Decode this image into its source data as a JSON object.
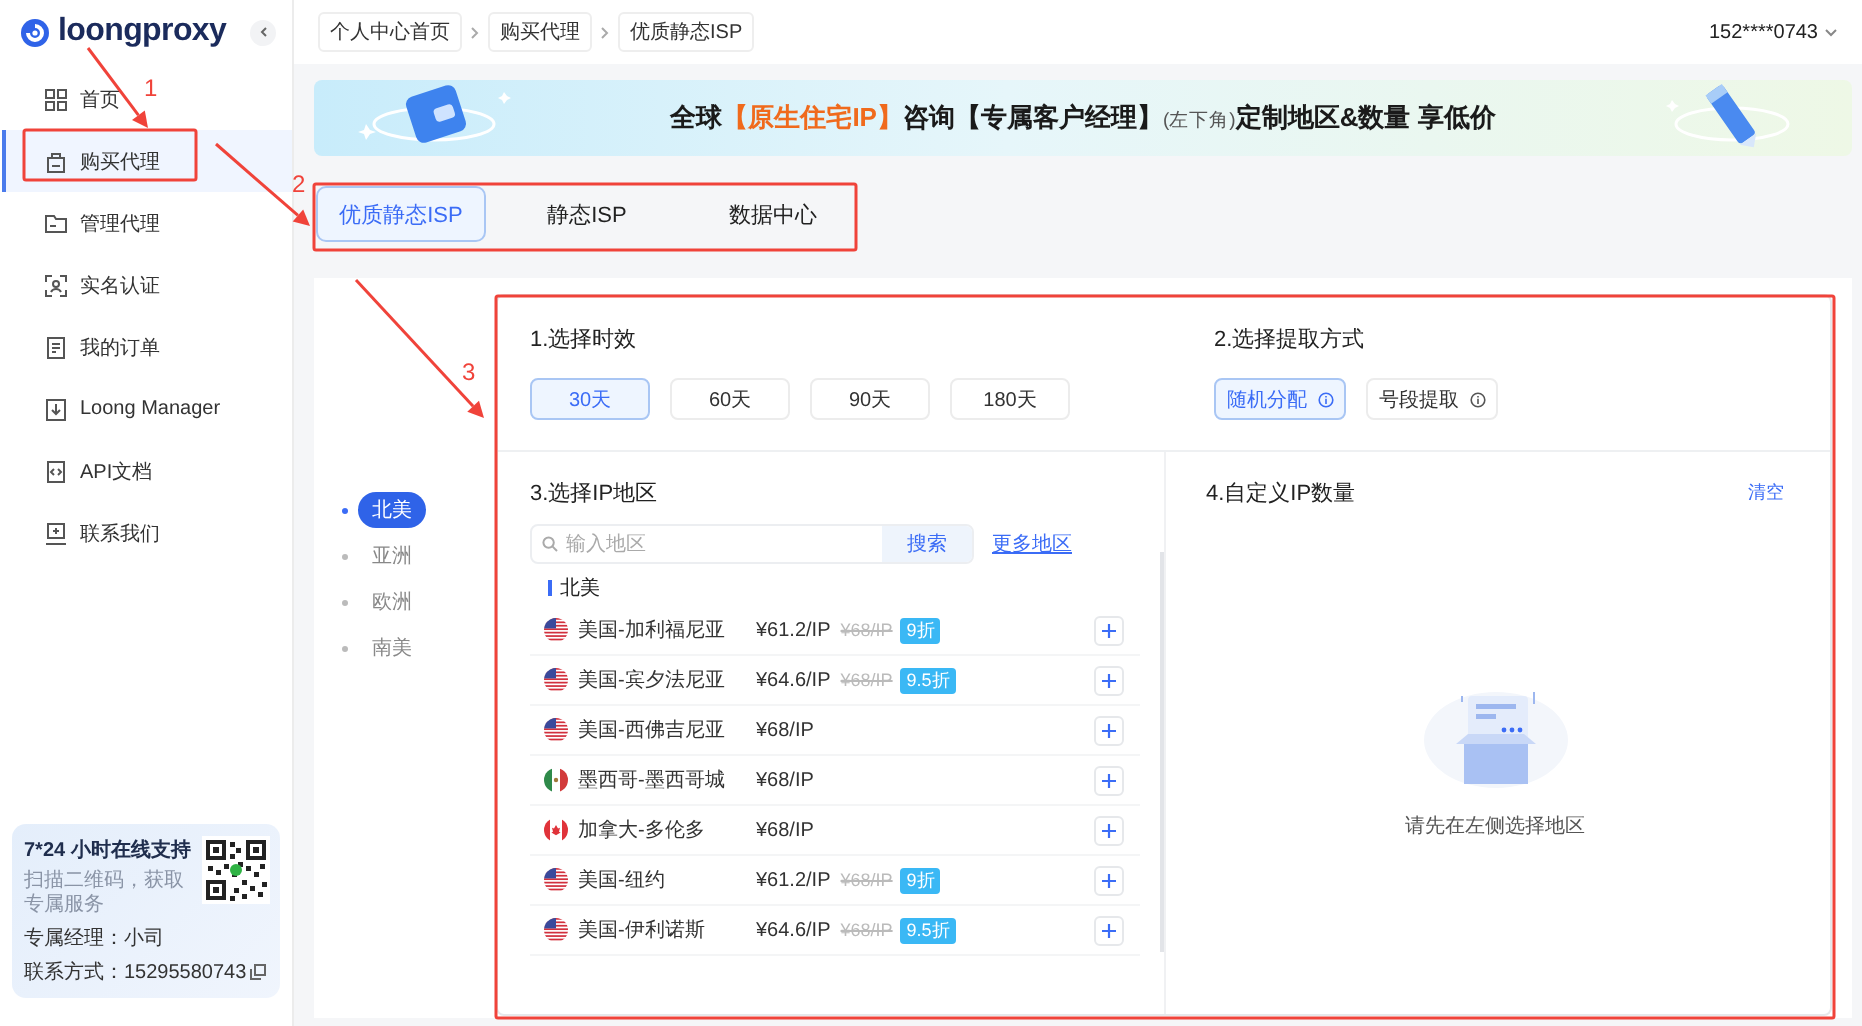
{
  "sidebar": {
    "logo": "loongproxy",
    "items": [
      {
        "label": "首页",
        "selected": false
      },
      {
        "label": "购买代理",
        "selected": true
      },
      {
        "label": "管理代理",
        "selected": false
      },
      {
        "label": "实名认证",
        "selected": false
      },
      {
        "label": "我的订单",
        "selected": false
      },
      {
        "label": "Loong Manager",
        "selected": false
      },
      {
        "label": "API文档",
        "selected": false
      },
      {
        "label": "联系我们",
        "selected": false
      }
    ],
    "support": {
      "title": "7*24 小时在线支持",
      "subtitle": "扫描二维码，获取专属服务",
      "manager": "专属经理：小司",
      "contact": "联系方式：15295580743"
    }
  },
  "topbar": {
    "breadcrumbs": [
      "个人中心首页",
      "购买代理",
      "优质静态ISP"
    ],
    "user": "152****0743"
  },
  "banner": {
    "segments": [
      {
        "kind": "normal",
        "text": "全球"
      },
      {
        "kind": "highlight",
        "text": "【原生住宅IP】"
      },
      {
        "kind": "normal",
        "text": "咨询【专属客户经理】"
      },
      {
        "kind": "note",
        "text": "(左下角)"
      },
      {
        "kind": "normal",
        "text": "定制地区&数量 享低价"
      }
    ]
  },
  "tabs": [
    {
      "label": "优质静态ISP",
      "selected": true
    },
    {
      "label": "静态ISP",
      "selected": false
    },
    {
      "label": "数据中心",
      "selected": false
    }
  ],
  "continents": [
    {
      "label": "北美",
      "selected": true
    },
    {
      "label": "亚洲",
      "selected": false
    },
    {
      "label": "欧洲",
      "selected": false
    },
    {
      "label": "南美",
      "selected": false
    }
  ],
  "duration": {
    "title": "1.选择时效",
    "options": [
      {
        "label": "30天",
        "selected": true
      },
      {
        "label": "60天",
        "selected": false
      },
      {
        "label": "90天",
        "selected": false
      },
      {
        "label": "180天",
        "selected": false
      }
    ]
  },
  "mode": {
    "title": "2.选择提取方式",
    "options": [
      {
        "label": "随机分配",
        "selected": true
      },
      {
        "label": "号段提取",
        "selected": false
      }
    ]
  },
  "region": {
    "title": "3.选择IP地区",
    "search": {
      "placeholder": "输入地区",
      "button": "搜索"
    },
    "more_link": "更多地区",
    "group": "北美",
    "rows": [
      {
        "kind": "us",
        "name": "美国-加利福尼亚",
        "price": "¥61.2/IP",
        "original_price": "¥68/IP",
        "discount": "9折"
      },
      {
        "kind": "us",
        "name": "美国-宾夕法尼亚",
        "price": "¥64.6/IP",
        "original_price": "¥68/IP",
        "discount": "9.5折"
      },
      {
        "kind": "us",
        "name": "美国-西佛吉尼亚",
        "price": "¥68/IP"
      },
      {
        "kind": "mx",
        "name": "墨西哥-墨西哥城",
        "price": "¥68/IP"
      },
      {
        "kind": "ca",
        "name": "加拿大-多伦多",
        "price": "¥68/IP"
      },
      {
        "kind": "us",
        "name": "美国-纽约",
        "price": "¥61.2/IP",
        "original_price": "¥68/IP",
        "discount": "9折"
      },
      {
        "kind": "us",
        "name": "美国-伊利诺斯",
        "price": "¥64.6/IP",
        "original_price": "¥68/IP",
        "discount": "9.5折"
      }
    ]
  },
  "quantity": {
    "title": "4.自定义IP数量",
    "clear": "清空",
    "empty_text": "请先在左侧选择地区"
  },
  "annotations": [
    {
      "label": "1"
    },
    {
      "label": "2"
    },
    {
      "label": "3"
    }
  ]
}
